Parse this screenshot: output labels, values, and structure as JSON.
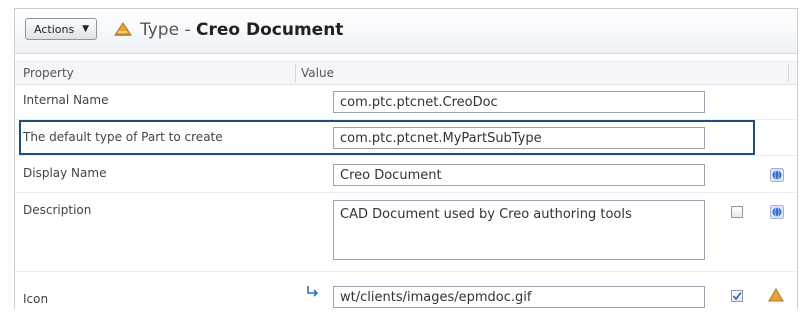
{
  "header": {
    "actions_label": "Actions",
    "title_prefix": "Type - ",
    "title_name": "Creo Document"
  },
  "columns": {
    "property": "Property",
    "value": "Value"
  },
  "rows": {
    "internal_name": {
      "label": "Internal Name",
      "value": "com.ptc.ptcnet.CreoDoc"
    },
    "default_part_type": {
      "label": "The default type of Part to create",
      "value": "com.ptc.ptcnet.MyPartSubType"
    },
    "display_name": {
      "label": "Display Name",
      "value": "Creo Document"
    },
    "description": {
      "label": "Description",
      "value": "CAD Document used by Creo authoring tools"
    },
    "icon": {
      "label": "Icon",
      "value": "wt/clients/images/epmdoc.gif",
      "checked": true
    }
  },
  "colors": {
    "highlight_border": "#1e4e79",
    "type_icon": "#e8a23c",
    "globe": "#2f6fc8"
  }
}
